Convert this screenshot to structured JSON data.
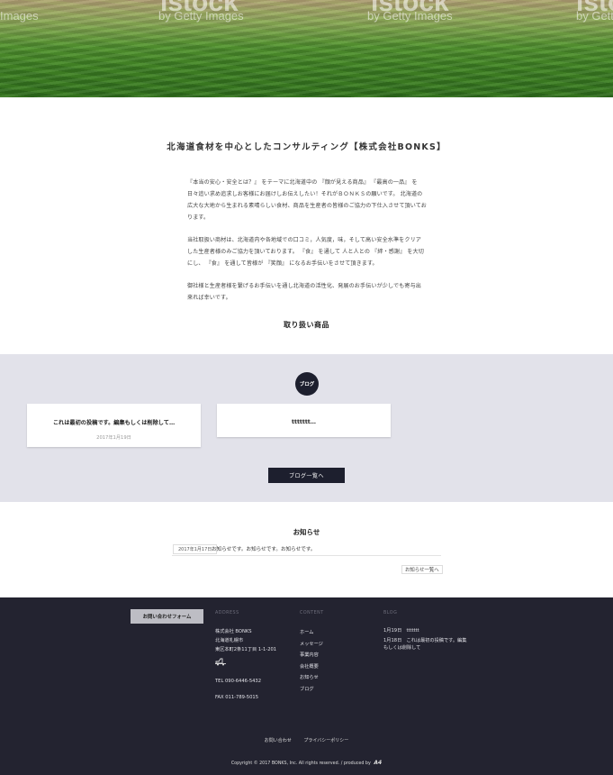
{
  "hero": {
    "watermarks": [
      {
        "big": "istock",
        "small": "Images"
      },
      {
        "big": "istock",
        "small": "by Getty Images"
      },
      {
        "big": "istock",
        "small": "by Getty Images"
      },
      {
        "big": "istock",
        "small": "by Getty"
      }
    ]
  },
  "intro": {
    "title": "北海道食材を中心としたコンサルティング【株式会社BONKS】",
    "paragraphs": [
      "『本当の安心・安全とは？』 をテーマに北海道中の 『顔が見える商品』 『最高の一品』 を日々追い求め追求しお客様にお届けしお伝えしたい！それがＢＯＮＫＳの願いです。 北海道の広大な大地から生まれる素晴らしい食材、商品を生産者の皆様のご協力の下仕入させて頂いております。",
      "当社取扱い商材は、北海道内や各地域での口コミ，人気度，味，そして高い安全水準をクリアした生産者様のみご協力を頂いております。 『食』 を通して 人と人との 『絆・感謝』 を大切にし、 『食』 を通して皆様が 『笑顔』 になるお手伝いをさせて頂きます。",
      "御社様と生産者様を繋げるお手伝いを通し北海道の活性化、発展のお手伝いが少しでも寄与出来れば幸いです。"
    ]
  },
  "products": {
    "title": "取り扱い商品"
  },
  "blog": {
    "badge": "ブログ",
    "cards": [
      {
        "title": "これは最初の投稿です。編集もしくは削除して…",
        "date": "2017年1月19日"
      },
      {
        "title": "ttttttt…",
        "date": ""
      }
    ],
    "button": "ブログ一覧へ"
  },
  "news": {
    "title": "お知らせ",
    "items": [
      {
        "date": "2017年1月17日",
        "text": "お知らせです。お知らせです。お知らせです。"
      }
    ],
    "more": "お知らせ一覧へ"
  },
  "footer": {
    "contact_button": "お問い合わせフォーム",
    "address": {
      "heading": "ADDRESS",
      "company": "株式会社 BONKS",
      "city": "北海道札幌市",
      "street": "東区本町2条11丁目 1-1-201",
      "tel": "TEL 090-6446-5432",
      "fax": "FAX 011-789-5015",
      "truck_icon": "truck-icon"
    },
    "content": {
      "heading": "CONTENT",
      "items": [
        "ホーム",
        "メッセージ",
        "事業内容",
        "会社概要",
        "お知らせ",
        "ブログ"
      ]
    },
    "blog": {
      "heading": "BLOG",
      "items": [
        "1月19日　ttttttt",
        "1月18日　これは最初の投稿です。編集もしくは削除して"
      ]
    },
    "links": [
      "お問い合わせ",
      "プライバシーポリシー"
    ],
    "copyright": "Copyright © 2017 BONKS, Inc. All rights reserved. / produced by",
    "logo": "A4"
  },
  "colors": {
    "navy": "#1d1f2e",
    "footer_bg": "#232330",
    "band_bg": "#e2e2ea"
  }
}
